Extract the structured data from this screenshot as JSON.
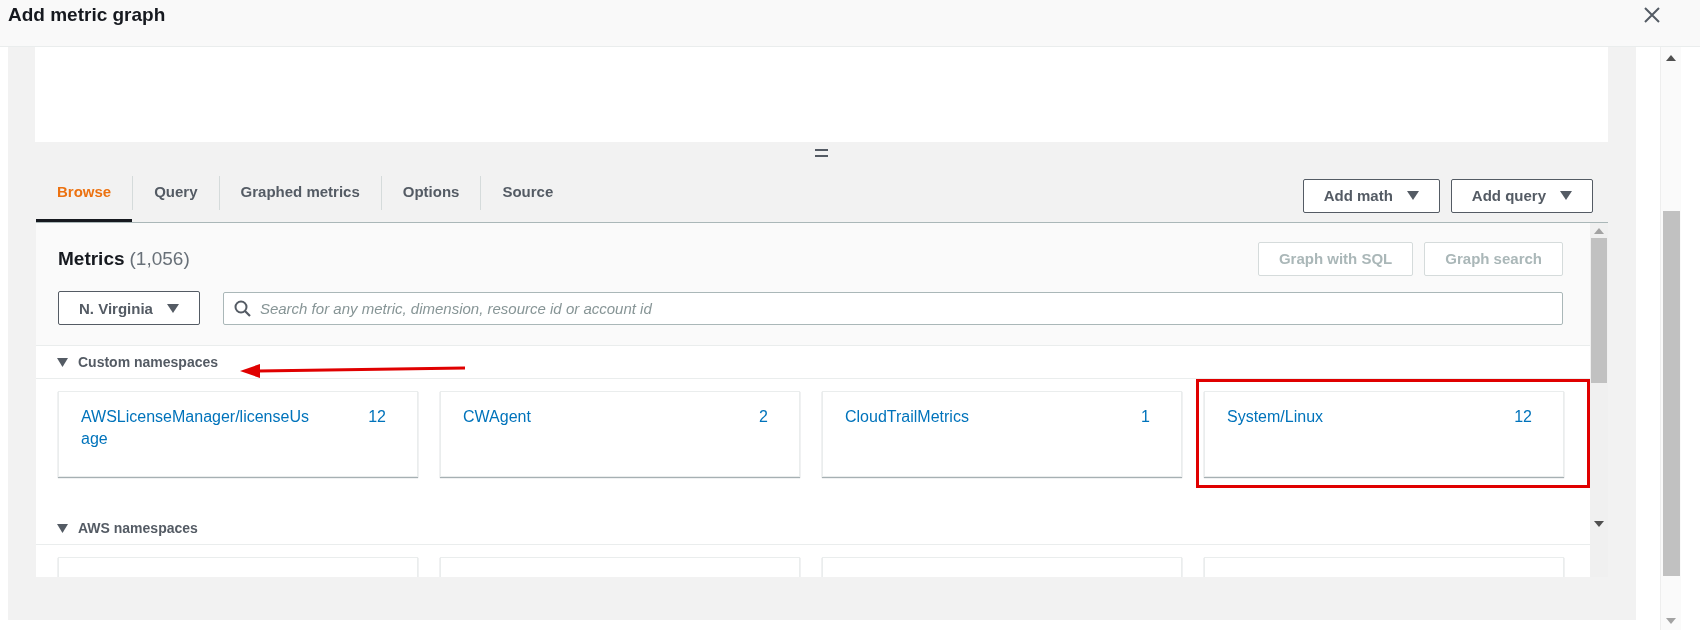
{
  "dialog": {
    "title": "Add metric graph"
  },
  "tabs": [
    {
      "label": "Browse",
      "selected": true
    },
    {
      "label": "Query",
      "selected": false
    },
    {
      "label": "Graphed metrics",
      "selected": false
    },
    {
      "label": "Options",
      "selected": false
    },
    {
      "label": "Source",
      "selected": false
    }
  ],
  "tab_actions": [
    {
      "label": "Add math"
    },
    {
      "label": "Add query"
    }
  ],
  "metrics": {
    "title": "Metrics",
    "count": "(1,056)"
  },
  "metric_actions": [
    {
      "label": "Graph with SQL",
      "disabled": true
    },
    {
      "label": "Graph search",
      "disabled": true
    }
  ],
  "region": {
    "value": "N. Virginia"
  },
  "search": {
    "placeholder": "Search for any metric, dimension, resource id or account id"
  },
  "sections": [
    {
      "title": "Custom namespaces",
      "expanded": true,
      "cards": [
        {
          "kind": "namespace",
          "name": "AWSLicenseManager/licenseUsage",
          "count": "12"
        },
        {
          "kind": "namespace",
          "name": "CWAgent",
          "count": "2"
        },
        {
          "kind": "namespace",
          "name": "CloudTrailMetrics",
          "count": "1"
        },
        {
          "kind": "namespace",
          "name": "System/Linux",
          "count": "12"
        }
      ]
    },
    {
      "title": "AWS namespaces",
      "expanded": true,
      "cards": [
        {
          "kind": "clipped"
        },
        {
          "kind": "clipped"
        },
        {
          "kind": "clipped"
        },
        {
          "kind": "clipped"
        }
      ]
    }
  ]
}
